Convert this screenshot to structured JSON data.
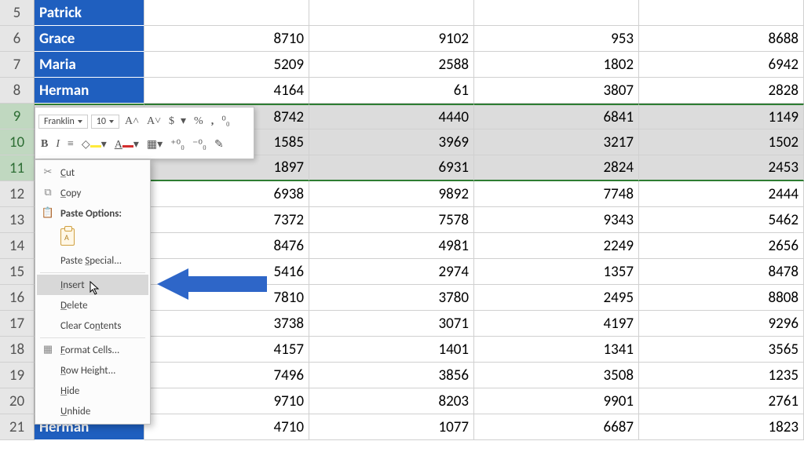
{
  "rows": [
    {
      "n": 5,
      "name": "Patrick",
      "v": [
        "",
        "",
        "",
        ""
      ],
      "sel": false
    },
    {
      "n": 6,
      "name": "Grace",
      "v": [
        8710,
        9102,
        953,
        8688
      ],
      "sel": false
    },
    {
      "n": 7,
      "name": "Maria",
      "v": [
        5209,
        2588,
        1802,
        6942
      ],
      "sel": false
    },
    {
      "n": 8,
      "name": "Herman",
      "v": [
        4164,
        61,
        3807,
        2828
      ],
      "sel": false
    },
    {
      "n": 9,
      "name": "",
      "v": [
        8742,
        4440,
        6841,
        1149
      ],
      "sel": true,
      "top": true
    },
    {
      "n": 10,
      "name": "",
      "v": [
        1585,
        3969,
        3217,
        1502
      ],
      "sel": true
    },
    {
      "n": 11,
      "name": "",
      "v": [
        1897,
        6931,
        2824,
        2453
      ],
      "sel": true,
      "bot": true
    },
    {
      "n": 12,
      "name": "",
      "v": [
        6938,
        9892,
        7748,
        2444
      ],
      "sel": false
    },
    {
      "n": 13,
      "name": "",
      "v": [
        7372,
        7578,
        9343,
        5462
      ],
      "sel": false
    },
    {
      "n": 14,
      "name": "",
      "v": [
        8476,
        4981,
        2249,
        2656
      ],
      "sel": false
    },
    {
      "n": 15,
      "name": "",
      "v": [
        5416,
        2974,
        1357,
        8478
      ],
      "sel": false
    },
    {
      "n": 16,
      "name": "",
      "v": [
        7810,
        3780,
        2495,
        8808
      ],
      "sel": false
    },
    {
      "n": 17,
      "name": "",
      "v": [
        3738,
        3071,
        4197,
        9296
      ],
      "sel": false
    },
    {
      "n": 18,
      "name": "",
      "v": [
        4157,
        1401,
        1341,
        3565
      ],
      "sel": false
    },
    {
      "n": 19,
      "name": "",
      "v": [
        7496,
        3856,
        3508,
        1235
      ],
      "sel": false
    },
    {
      "n": 20,
      "name": "",
      "v": [
        9710,
        8203,
        9901,
        2761
      ],
      "sel": false
    },
    {
      "n": 21,
      "name": "Herman",
      "v": [
        4710,
        1077,
        6687,
        1823
      ],
      "sel": false
    }
  ],
  "mini": {
    "font": "Franklin",
    "size": "10",
    "incA": "A˄",
    "decA": "A˅",
    "dollar": "$",
    "pct": "%",
    "comma": ",",
    "dec": "⁰⁰",
    "b": "B",
    "i": "I",
    "u": "≡",
    "fill": "◆",
    "fontcolor": "A",
    "border": "▦",
    "inc": ".0",
    "dec2": ".00",
    "brush": "✎"
  },
  "ctx": {
    "cut": "Cut",
    "copy": "Copy",
    "paste_options": "Paste Options:",
    "paste_special": "Paste Special...",
    "insert": "Insert",
    "delete": "Delete",
    "clear": "Clear Contents",
    "format_cells": "Format Cells...",
    "row_height": "Row Height...",
    "hide": "Hide",
    "unhide": "Unhide",
    "paste_glyph": "A"
  }
}
